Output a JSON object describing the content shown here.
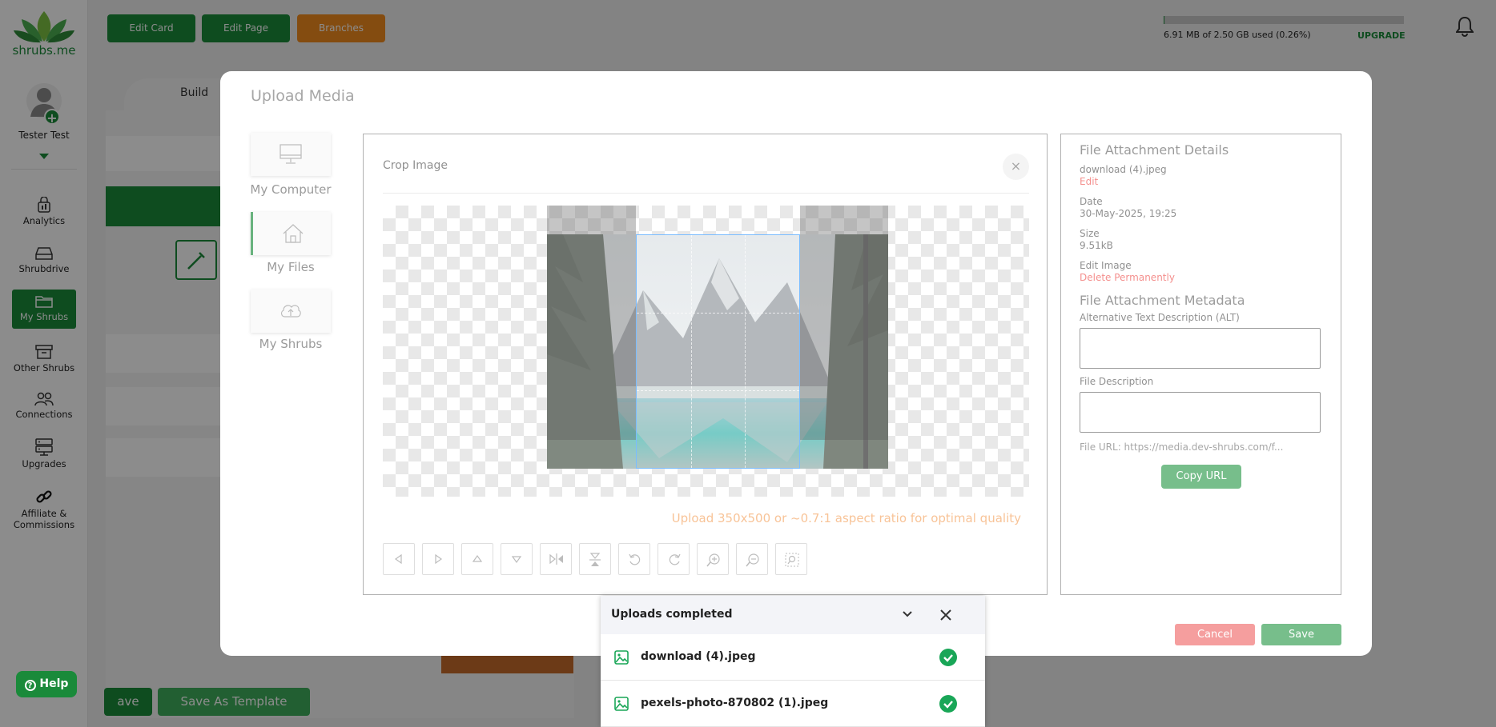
{
  "brand": {
    "name": "shrubs.me",
    "color": "#1a8a3a"
  },
  "user": {
    "name": "Tester Test"
  },
  "sidebar": {
    "items": [
      {
        "label": "Analytics",
        "icon": "analytics-icon"
      },
      {
        "label": "Shrubdrive",
        "icon": "drive-icon"
      },
      {
        "label": "My Shrubs",
        "icon": "folder-icon",
        "active": true
      },
      {
        "label": "Other Shrubs",
        "icon": "archive-icon"
      },
      {
        "label": "Connections",
        "icon": "users-icon"
      },
      {
        "label": "Upgrades",
        "icon": "server-icon"
      },
      {
        "label": "Affiliate & Commissions",
        "icon": "link-icon"
      }
    ],
    "help_label": "Help"
  },
  "topbar": {
    "edit_card": "Edit Card",
    "edit_page": "Edit Page",
    "branches": "Branches",
    "storage_text": "6.91 MB of 2.50 GB used (0.26%)",
    "storage_percent": 0.26,
    "upgrade": "UPGRADE"
  },
  "background": {
    "build_tab": "Build",
    "save_label": "ave",
    "save_template_label": "Save As Template"
  },
  "modal": {
    "title": "Upload Media",
    "sources": [
      {
        "label": "My Computer",
        "icon": "monitor-icon"
      },
      {
        "label": "My Files",
        "icon": "home-icon",
        "active": true
      },
      {
        "label": "My Shrubs",
        "icon": "cloud-upload-icon"
      }
    ],
    "crop": {
      "title": "Crop Image",
      "close": "×",
      "hint": "Upload 350x500 or ~0.7:1 aspect ratio for optimal quality",
      "tools": [
        "move-left-icon",
        "move-right-icon",
        "move-up-icon",
        "move-down-icon",
        "flip-horizontal-icon",
        "flip-vertical-icon",
        "rotate-left-icon",
        "rotate-right-icon",
        "zoom-in-icon",
        "zoom-out-icon",
        "reset-crop-icon"
      ]
    },
    "details": {
      "heading": "File Attachment Details",
      "filename": "download (4).jpeg",
      "edit": "Edit",
      "date_label": "Date",
      "date_value": "30-May-2025, 19:25",
      "size_label": "Size",
      "size_value": "9.51kB",
      "edit_image": "Edit Image",
      "delete": "Delete Permanently",
      "metadata_heading": "File Attachment Metadata",
      "alt_label": "Alternative Text Description (ALT)",
      "alt_value": "",
      "desc_label": "File Description",
      "desc_value": "",
      "url": "File URL: https://media.dev-shrubs.com/f...",
      "copy_url": "Copy URL"
    },
    "cancel": "Cancel",
    "save": "Save"
  },
  "uploads": {
    "title": "Uploads completed",
    "files": [
      {
        "name": "download (4).jpeg",
        "status": "completed"
      },
      {
        "name": "pexels-photo-870802 (1).jpeg",
        "status": "completed"
      }
    ]
  }
}
